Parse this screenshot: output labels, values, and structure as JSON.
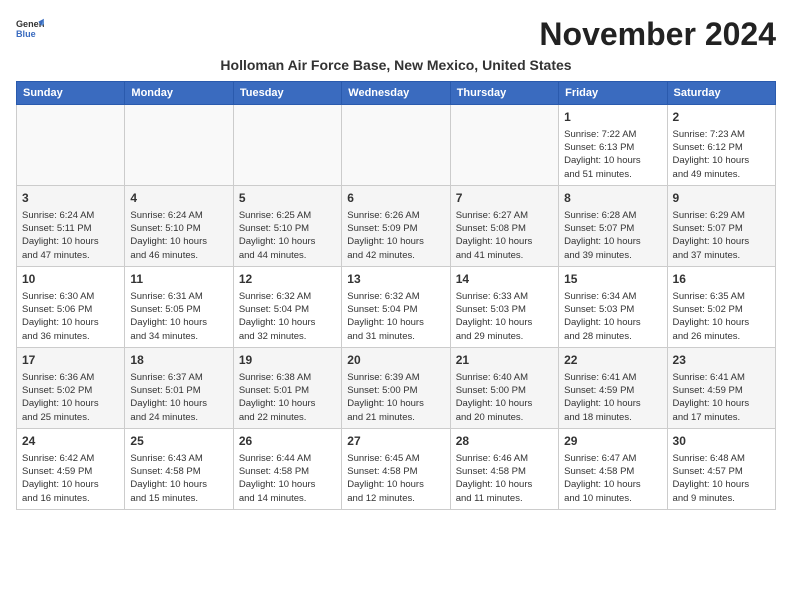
{
  "header": {
    "logo_line1": "General",
    "logo_line2": "Blue",
    "month_title": "November 2024",
    "subtitle": "Holloman Air Force Base, New Mexico, United States"
  },
  "weekdays": [
    "Sunday",
    "Monday",
    "Tuesday",
    "Wednesday",
    "Thursday",
    "Friday",
    "Saturday"
  ],
  "weeks": [
    [
      {
        "day": "",
        "info": ""
      },
      {
        "day": "",
        "info": ""
      },
      {
        "day": "",
        "info": ""
      },
      {
        "day": "",
        "info": ""
      },
      {
        "day": "",
        "info": ""
      },
      {
        "day": "1",
        "info": "Sunrise: 7:22 AM\nSunset: 6:13 PM\nDaylight: 10 hours\nand 51 minutes."
      },
      {
        "day": "2",
        "info": "Sunrise: 7:23 AM\nSunset: 6:12 PM\nDaylight: 10 hours\nand 49 minutes."
      }
    ],
    [
      {
        "day": "3",
        "info": "Sunrise: 6:24 AM\nSunset: 5:11 PM\nDaylight: 10 hours\nand 47 minutes."
      },
      {
        "day": "4",
        "info": "Sunrise: 6:24 AM\nSunset: 5:10 PM\nDaylight: 10 hours\nand 46 minutes."
      },
      {
        "day": "5",
        "info": "Sunrise: 6:25 AM\nSunset: 5:10 PM\nDaylight: 10 hours\nand 44 minutes."
      },
      {
        "day": "6",
        "info": "Sunrise: 6:26 AM\nSunset: 5:09 PM\nDaylight: 10 hours\nand 42 minutes."
      },
      {
        "day": "7",
        "info": "Sunrise: 6:27 AM\nSunset: 5:08 PM\nDaylight: 10 hours\nand 41 minutes."
      },
      {
        "day": "8",
        "info": "Sunrise: 6:28 AM\nSunset: 5:07 PM\nDaylight: 10 hours\nand 39 minutes."
      },
      {
        "day": "9",
        "info": "Sunrise: 6:29 AM\nSunset: 5:07 PM\nDaylight: 10 hours\nand 37 minutes."
      }
    ],
    [
      {
        "day": "10",
        "info": "Sunrise: 6:30 AM\nSunset: 5:06 PM\nDaylight: 10 hours\nand 36 minutes."
      },
      {
        "day": "11",
        "info": "Sunrise: 6:31 AM\nSunset: 5:05 PM\nDaylight: 10 hours\nand 34 minutes."
      },
      {
        "day": "12",
        "info": "Sunrise: 6:32 AM\nSunset: 5:04 PM\nDaylight: 10 hours\nand 32 minutes."
      },
      {
        "day": "13",
        "info": "Sunrise: 6:32 AM\nSunset: 5:04 PM\nDaylight: 10 hours\nand 31 minutes."
      },
      {
        "day": "14",
        "info": "Sunrise: 6:33 AM\nSunset: 5:03 PM\nDaylight: 10 hours\nand 29 minutes."
      },
      {
        "day": "15",
        "info": "Sunrise: 6:34 AM\nSunset: 5:03 PM\nDaylight: 10 hours\nand 28 minutes."
      },
      {
        "day": "16",
        "info": "Sunrise: 6:35 AM\nSunset: 5:02 PM\nDaylight: 10 hours\nand 26 minutes."
      }
    ],
    [
      {
        "day": "17",
        "info": "Sunrise: 6:36 AM\nSunset: 5:02 PM\nDaylight: 10 hours\nand 25 minutes."
      },
      {
        "day": "18",
        "info": "Sunrise: 6:37 AM\nSunset: 5:01 PM\nDaylight: 10 hours\nand 24 minutes."
      },
      {
        "day": "19",
        "info": "Sunrise: 6:38 AM\nSunset: 5:01 PM\nDaylight: 10 hours\nand 22 minutes."
      },
      {
        "day": "20",
        "info": "Sunrise: 6:39 AM\nSunset: 5:00 PM\nDaylight: 10 hours\nand 21 minutes."
      },
      {
        "day": "21",
        "info": "Sunrise: 6:40 AM\nSunset: 5:00 PM\nDaylight: 10 hours\nand 20 minutes."
      },
      {
        "day": "22",
        "info": "Sunrise: 6:41 AM\nSunset: 4:59 PM\nDaylight: 10 hours\nand 18 minutes."
      },
      {
        "day": "23",
        "info": "Sunrise: 6:41 AM\nSunset: 4:59 PM\nDaylight: 10 hours\nand 17 minutes."
      }
    ],
    [
      {
        "day": "24",
        "info": "Sunrise: 6:42 AM\nSunset: 4:59 PM\nDaylight: 10 hours\nand 16 minutes."
      },
      {
        "day": "25",
        "info": "Sunrise: 6:43 AM\nSunset: 4:58 PM\nDaylight: 10 hours\nand 15 minutes."
      },
      {
        "day": "26",
        "info": "Sunrise: 6:44 AM\nSunset: 4:58 PM\nDaylight: 10 hours\nand 14 minutes."
      },
      {
        "day": "27",
        "info": "Sunrise: 6:45 AM\nSunset: 4:58 PM\nDaylight: 10 hours\nand 12 minutes."
      },
      {
        "day": "28",
        "info": "Sunrise: 6:46 AM\nSunset: 4:58 PM\nDaylight: 10 hours\nand 11 minutes."
      },
      {
        "day": "29",
        "info": "Sunrise: 6:47 AM\nSunset: 4:58 PM\nDaylight: 10 hours\nand 10 minutes."
      },
      {
        "day": "30",
        "info": "Sunrise: 6:48 AM\nSunset: 4:57 PM\nDaylight: 10 hours\nand 9 minutes."
      }
    ]
  ]
}
